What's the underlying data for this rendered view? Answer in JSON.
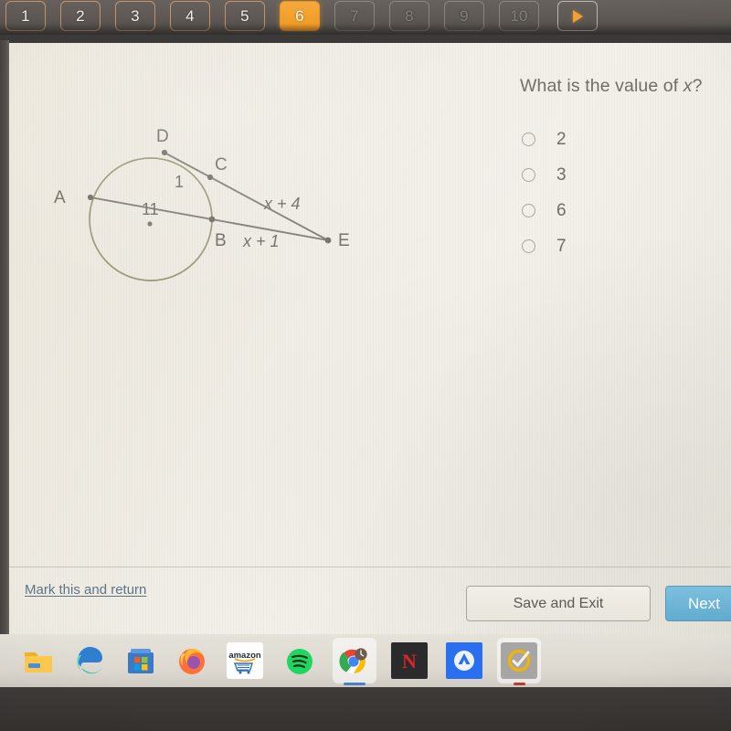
{
  "question_nav": {
    "tabs": [
      {
        "label": "1",
        "state": "visited"
      },
      {
        "label": "2",
        "state": "visited"
      },
      {
        "label": "3",
        "state": "visited"
      },
      {
        "label": "4",
        "state": "visited"
      },
      {
        "label": "5",
        "state": "visited"
      },
      {
        "label": "6",
        "state": "active"
      },
      {
        "label": "7",
        "state": "disabled"
      },
      {
        "label": "8",
        "state": "disabled"
      },
      {
        "label": "9",
        "state": "disabled"
      },
      {
        "label": "10",
        "state": "disabled"
      }
    ],
    "next_arrow_icon": "play-triangle-icon",
    "active_color": "#f0991f",
    "outline_color": "#e2a36a",
    "bar_color": "#5d5854"
  },
  "figure": {
    "description": "Circle with secant segments from external point E",
    "stroke_color": "#9a9478",
    "line_color": "#7d7a73",
    "labels": {
      "point_a": "A",
      "point_b": "B",
      "point_c": "C",
      "point_d": "D",
      "point_e": "E",
      "chord_ab": "11",
      "chord_dc": "1",
      "segment_de": "x + 4",
      "segment_be": "x + 1"
    }
  },
  "question": {
    "text_before": "What is the value of ",
    "variable": "x",
    "text_after": "?"
  },
  "choices": [
    {
      "label": "2",
      "selected": false
    },
    {
      "label": "3",
      "selected": false
    },
    {
      "label": "6",
      "selected": false
    },
    {
      "label": "7",
      "selected": false
    }
  ],
  "footer": {
    "mark_link": "Mark this and return",
    "save_exit": "Save and Exit",
    "next": "Next",
    "next_color": "#6fb6d8"
  },
  "taskbar": {
    "items": [
      {
        "name": "file-explorer-icon",
        "label": "File Explorer"
      },
      {
        "name": "microsoft-edge-icon",
        "label": "Microsoft Edge"
      },
      {
        "name": "microsoft-store-icon",
        "label": "Microsoft Store"
      },
      {
        "name": "firefox-icon",
        "label": "Firefox"
      },
      {
        "name": "amazon-icon",
        "label": "amazon"
      },
      {
        "name": "spotify-icon",
        "label": "Spotify"
      },
      {
        "name": "google-chrome-icon",
        "label": "Google Chrome"
      },
      {
        "name": "netflix-icon",
        "label": "N"
      },
      {
        "name": "nordvpn-icon",
        "label": "NordVPN"
      },
      {
        "name": "norton-icon",
        "label": "Norton"
      }
    ]
  }
}
